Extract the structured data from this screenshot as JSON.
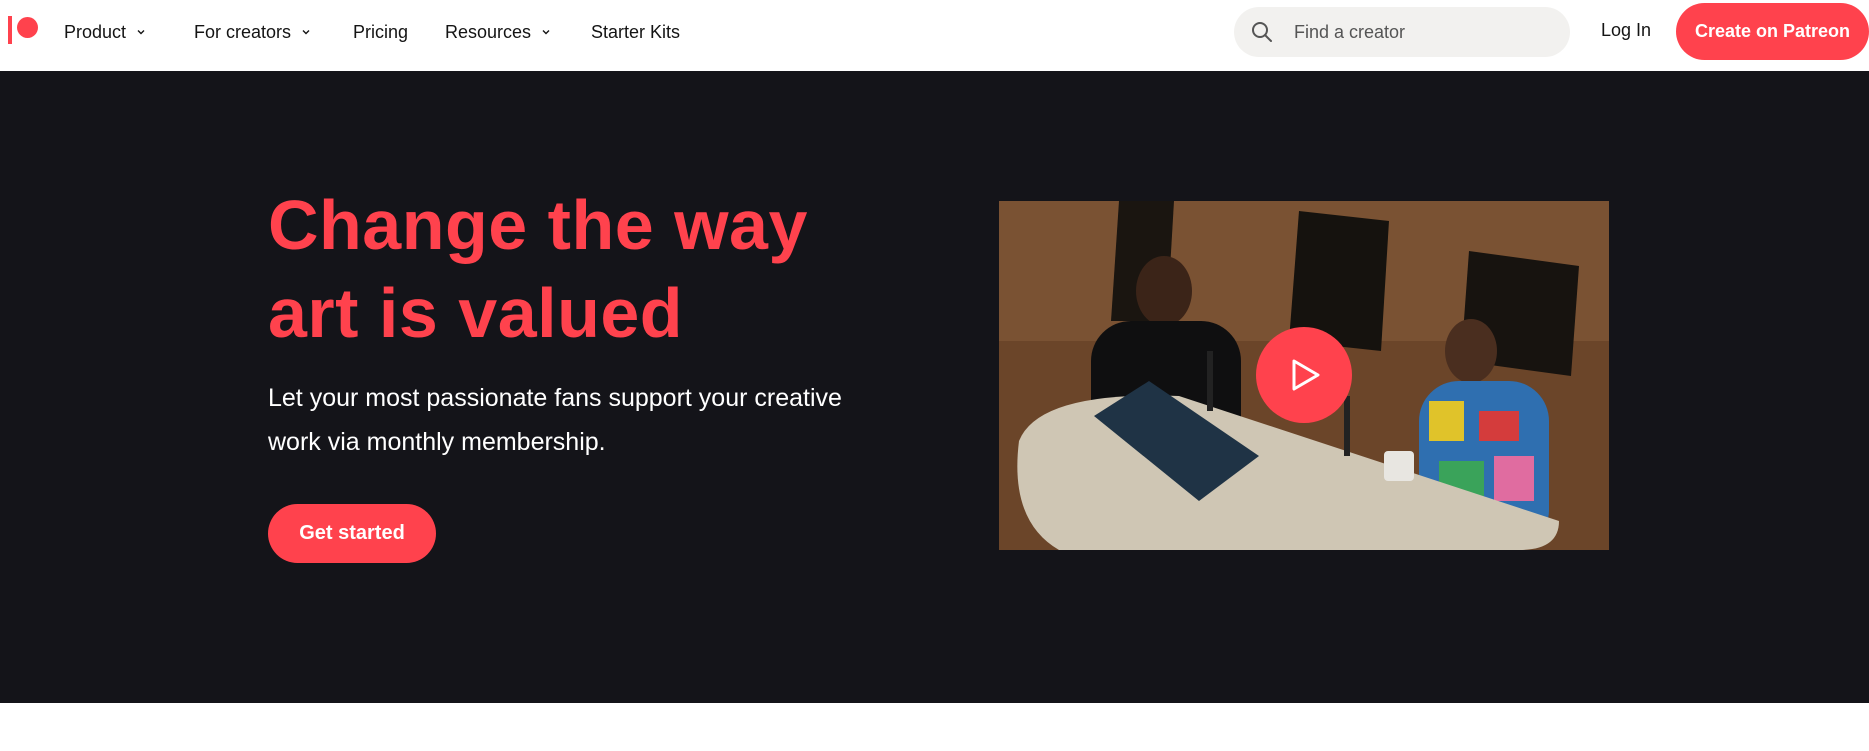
{
  "nav": {
    "items": [
      {
        "label": "Product",
        "has_dropdown": true
      },
      {
        "label": "For creators",
        "has_dropdown": true
      },
      {
        "label": "Pricing",
        "has_dropdown": false
      },
      {
        "label": "Resources",
        "has_dropdown": true
      },
      {
        "label": "Starter Kits",
        "has_dropdown": false
      }
    ],
    "search": {
      "placeholder": "Find a creator",
      "value": ""
    },
    "login_label": "Log In",
    "cta_label": "Create on Patreon"
  },
  "hero": {
    "title": "Change the way art is valued",
    "subtitle": "Let your most passionate fans support your creative work via monthly membership.",
    "cta_label": "Get started"
  },
  "video": {
    "play_icon": "play-icon"
  },
  "colors": {
    "brand": "#ff424d",
    "hero_background": "#141419",
    "search_background": "#f2f1ef"
  }
}
